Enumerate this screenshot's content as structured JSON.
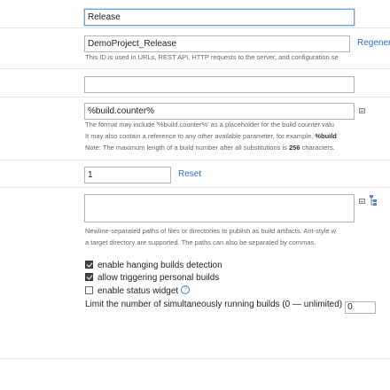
{
  "build_config": {
    "name": {
      "value": "Release"
    },
    "build_config_id": {
      "value": "DemoProject_Release",
      "regenerate_link": "Regener",
      "note": "This ID is used in URLs, REST API, HTTP requests to the server, and configuration se"
    },
    "description": {
      "value": ""
    },
    "build_number_format": {
      "value": "%build.counter%",
      "note_line1": "The format may include '%build.counter%' as a placeholder for the build counter valu",
      "note_line2_prefix": "It may also contain a reference to any other available parameter, for example, ",
      "note_line2_bold": "%build",
      "note_line3_prefix": "Note: The maximum length of a build number after all substitutions is ",
      "note_line3_bold": "256",
      "note_line3_suffix": " characters."
    },
    "build_counter": {
      "value": "1",
      "reset_link": "Reset"
    },
    "artifact_paths": {
      "value": "",
      "note_line1": "Newline-separated paths of files or directories to publish as build artifacts. Ant-style w",
      "note_line2": "a target directory are supported. The paths can also be separated by commas."
    },
    "options": [
      {
        "label": "enable hanging builds detection",
        "checked": true
      },
      {
        "label": "allow triggering personal builds",
        "checked": true
      },
      {
        "label": "enable status widget",
        "checked": false,
        "help": "?"
      }
    ],
    "limit": {
      "label": "Limit the number of simultaneously running builds (0 — unlimited)",
      "value": "0"
    }
  },
  "icons": {
    "text_field_expand": "small-textbox-icon",
    "artifact_tree": "tree-browse-icon"
  },
  "colors": {
    "link": "#2f6fbf",
    "focus_border": "#6f9fd8"
  }
}
